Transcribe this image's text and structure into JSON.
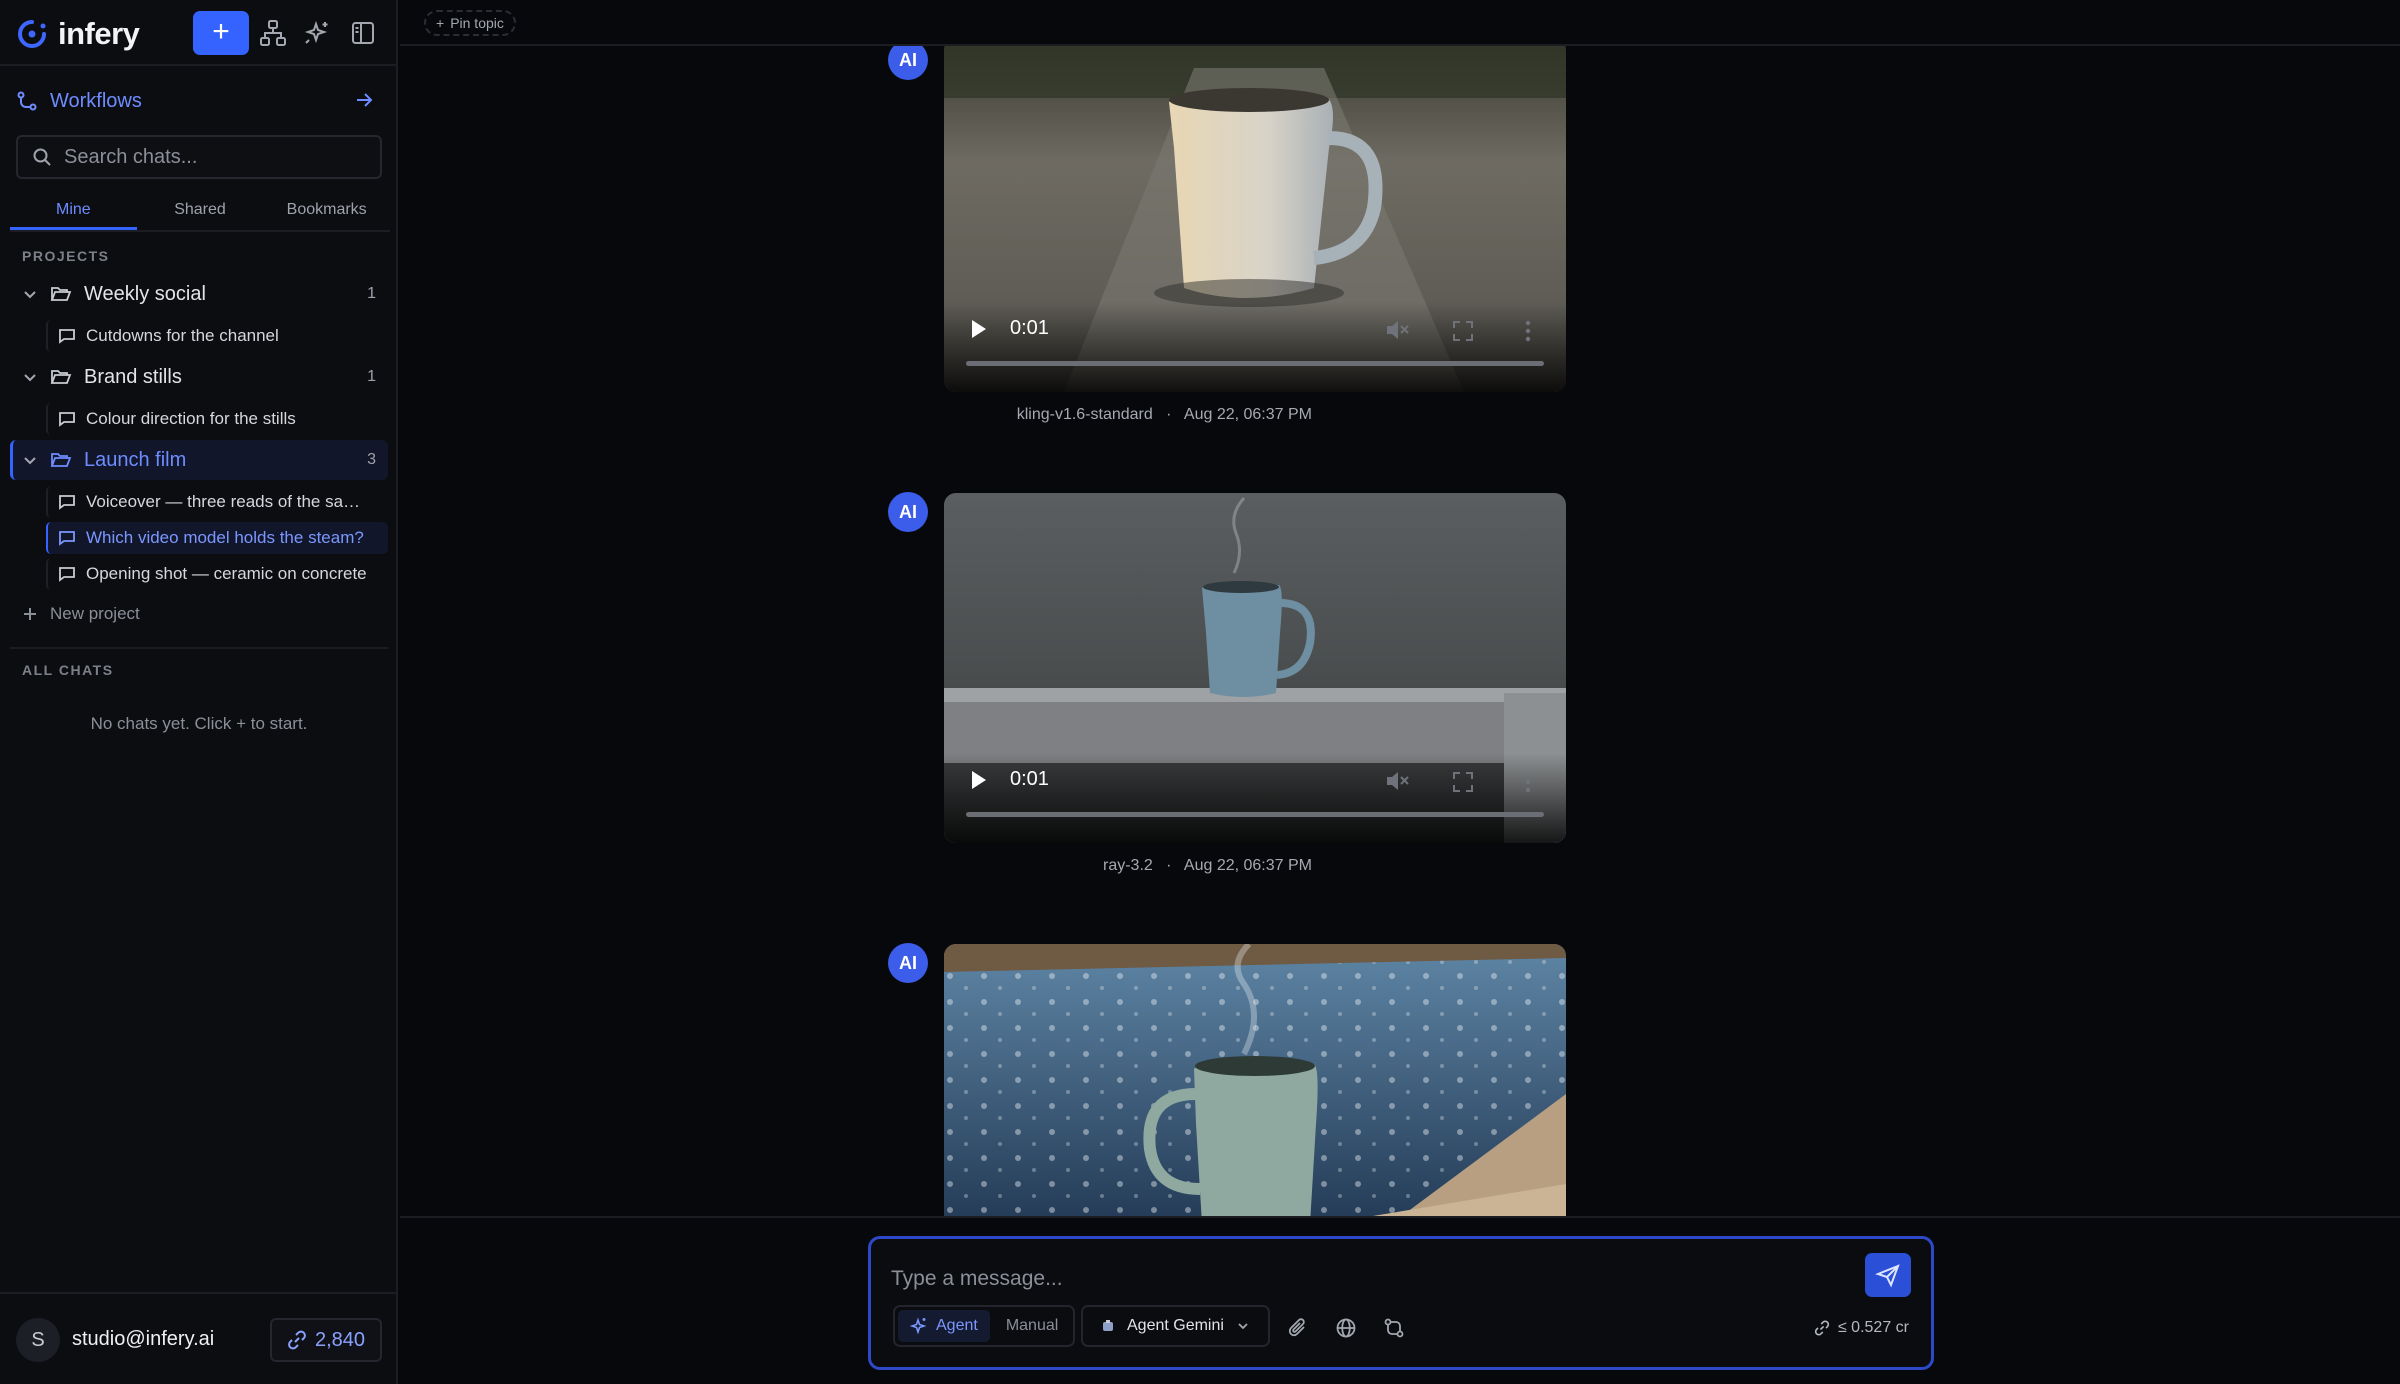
{
  "app": {
    "name": "infery"
  },
  "sidebar": {
    "workflows_label": "Workflows",
    "search_placeholder": "Search chats...",
    "tabs": [
      "Mine",
      "Shared",
      "Bookmarks"
    ],
    "projects_label": "PROJECTS",
    "projects": [
      {
        "name": "Weekly social",
        "count": "1",
        "chats": [
          "Cutdowns for the channel"
        ]
      },
      {
        "name": "Brand stills",
        "count": "1",
        "chats": [
          "Colour direction for the stills"
        ]
      },
      {
        "name": "Launch film",
        "count": "3",
        "chats": [
          "Voiceover — three reads of the sa…",
          "Which video model holds the steam?",
          "Opening shot — ceramic on concrete"
        ]
      }
    ],
    "new_project_label": "New project",
    "all_chats_label": "ALL CHATS",
    "empty_text": "No chats yet. Click + to start.",
    "user": {
      "initial": "S",
      "email": "studio@infery.ai",
      "credits": "2,840"
    }
  },
  "main": {
    "pin_topic_label": "Pin topic",
    "messages": [
      {
        "avatar": "AI",
        "time": "0:01",
        "model": "kling-v1.6-standard",
        "timestamp": "Aug 22, 06:37 PM"
      },
      {
        "avatar": "AI",
        "time": "0:01",
        "model": "ray-3.2",
        "timestamp": "Aug 22, 06:37 PM"
      },
      {
        "avatar": "AI"
      }
    ],
    "meta_separator": "·"
  },
  "composer": {
    "placeholder": "Type a message...",
    "modes": [
      "Agent",
      "Manual"
    ],
    "model": "Agent Gemini",
    "cost": "≤ 0.527 cr"
  },
  "colors": {
    "accent": "#3563ff",
    "background": "#07080b",
    "sidebar": "#0c0d11"
  }
}
